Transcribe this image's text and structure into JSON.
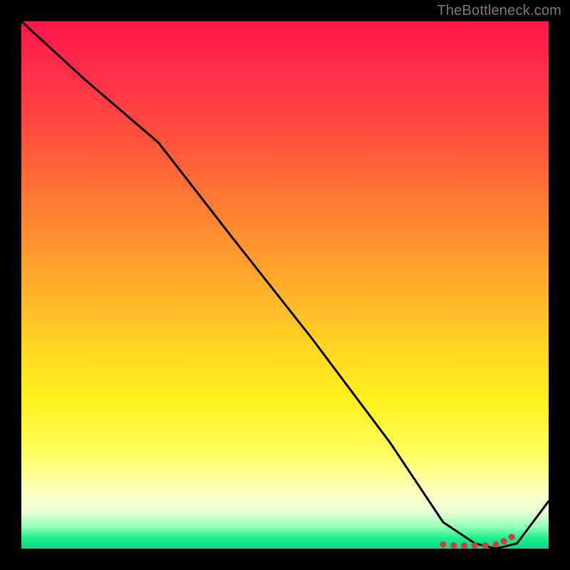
{
  "attribution": "TheBottleneck.com",
  "chart_data": {
    "type": "line",
    "title": "",
    "xlabel": "",
    "ylabel": "",
    "xlim": [
      0,
      100
    ],
    "ylim": [
      0,
      100
    ],
    "series": [
      {
        "name": "curve",
        "x": [
          0,
          12,
          26,
          40,
          55,
          70,
          80,
          86,
          90,
          94,
          100
        ],
        "y": [
          100,
          89,
          77,
          59,
          40,
          20,
          5,
          1,
          0,
          1,
          9
        ]
      }
    ],
    "markers": {
      "name": "bottom-cluster",
      "x": [
        80,
        82,
        84,
        86,
        88,
        90,
        91.5,
        93
      ],
      "y": [
        0.8,
        0.6,
        0.6,
        0.6,
        0.6,
        0.8,
        1.4,
        2.2
      ],
      "color": "#d23e3e",
      "size": 9
    },
    "background_gradient": {
      "direction": "top-to-bottom",
      "stops": [
        {
          "pos": 0.0,
          "color": "#ff1548"
        },
        {
          "pos": 0.35,
          "color": "#ff7d33"
        },
        {
          "pos": 0.62,
          "color": "#ffd622"
        },
        {
          "pos": 0.9,
          "color": "#fcffc8"
        },
        {
          "pos": 1.0,
          "color": "#0cd788"
        }
      ]
    }
  }
}
